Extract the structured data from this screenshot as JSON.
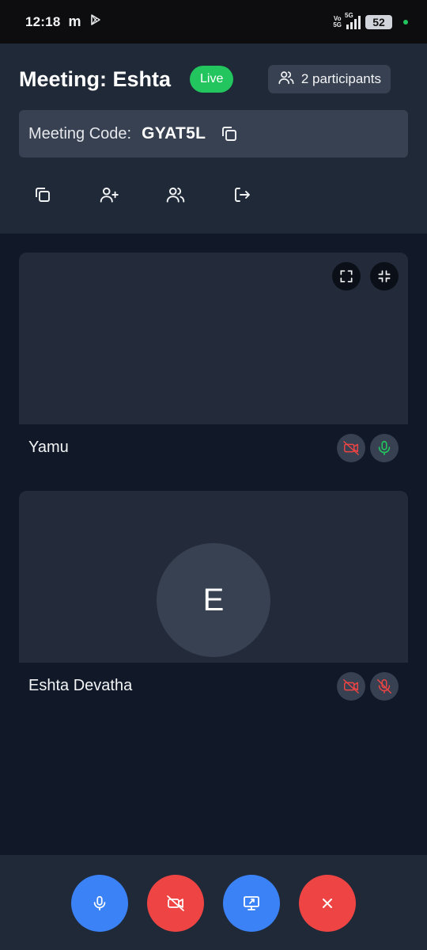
{
  "status_bar": {
    "time": "12:18",
    "app_glyph": "m",
    "network_top": "Vo",
    "network_bottom": "5G",
    "network_type": "5G",
    "battery": "52"
  },
  "header": {
    "title": "Meeting: Eshta",
    "live_label": "Live",
    "participants_label": "2 participants",
    "code_label": "Meeting Code:",
    "code_value": "GYAT5L",
    "actions": [
      "copy-icon",
      "user-plus-icon",
      "users-icon",
      "exit-icon"
    ]
  },
  "tiles": [
    {
      "name": "Yamu",
      "camera": "off",
      "mic": "on",
      "tools": [
        "fullscreen-icon",
        "minimize-icon"
      ]
    },
    {
      "name": "Eshta Devatha",
      "avatar_initial": "E",
      "camera": "off",
      "mic": "off"
    }
  ],
  "controls": [
    "mic-icon",
    "camera-off-icon",
    "screen-share-icon",
    "close-icon"
  ],
  "colors": {
    "live": "#22c55e",
    "primary": "#3b82f6",
    "danger": "#ef4444",
    "mic_on": "#22c55e",
    "off_indicator": "#ef4444"
  }
}
